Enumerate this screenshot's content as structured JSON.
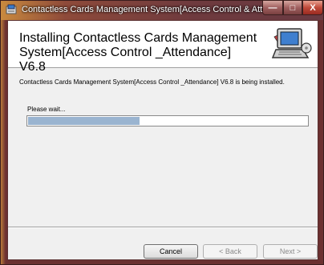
{
  "window": {
    "title": "Contactless Cards Management System[Access Control & Attendanc...",
    "caption_buttons": {
      "minimize": "—",
      "maximize": "□",
      "close": "X"
    }
  },
  "header": {
    "title": "Installing Contactless Cards Management System[Access Control _Attendance] V6.8",
    "icon": "computer-setup-icon"
  },
  "body": {
    "message": "Contactless Cards Management System[Access Control _Attendance] V6.8 is being installed.",
    "wait_label": "Please wait...",
    "progress_fraction": 0.4
  },
  "buttons": {
    "cancel": "Cancel",
    "back": "< Back",
    "next": "Next >"
  }
}
